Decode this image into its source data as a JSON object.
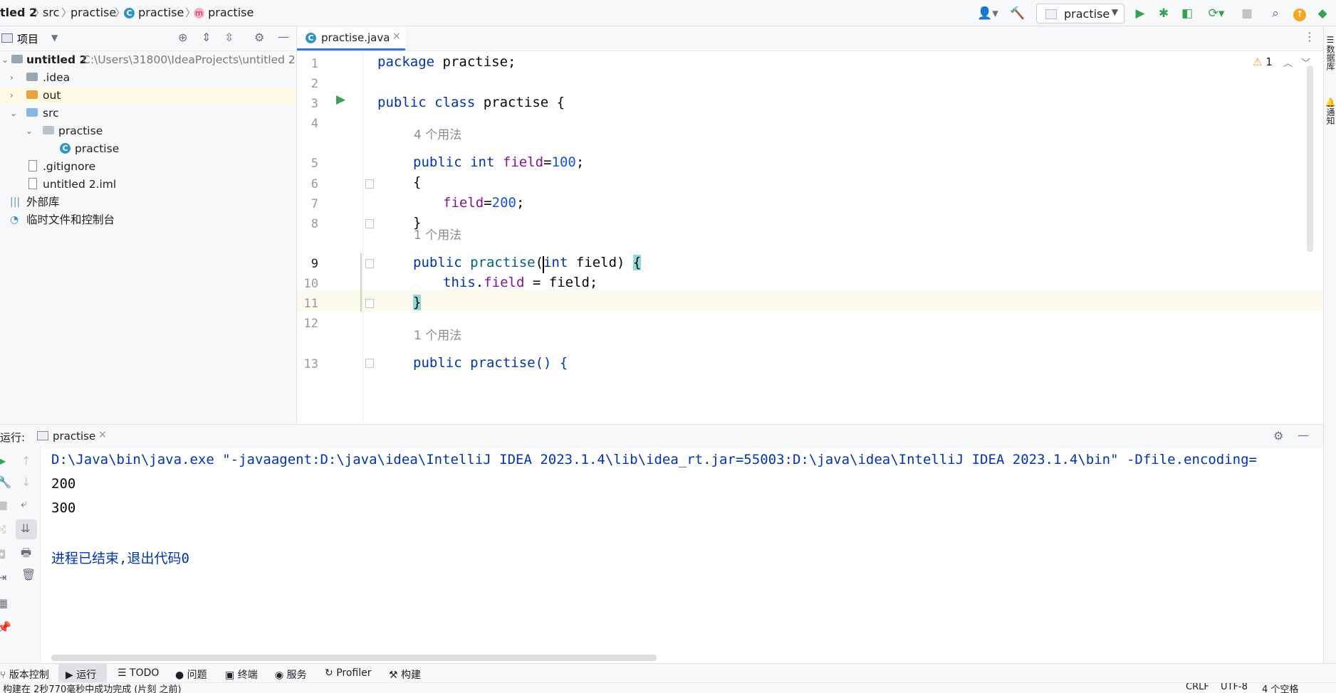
{
  "breadcrumb": {
    "items": [
      "tled 2",
      "src",
      "practise",
      "practise",
      "practise"
    ]
  },
  "toolbar": {
    "run_config": "practise"
  },
  "project_panel": {
    "title": "项目",
    "tree": [
      {
        "label": "untitled 2",
        "path": "C:\\Users\\31800\\IdeaProjects\\untitled 2"
      },
      {
        "label": ".idea"
      },
      {
        "label": "out"
      },
      {
        "label": "src"
      },
      {
        "label": "practise"
      },
      {
        "label": "practise"
      },
      {
        "label": ".gitignore"
      },
      {
        "label": "untitled 2.iml"
      },
      {
        "label": "外部库"
      },
      {
        "label": "临时文件和控制台"
      }
    ]
  },
  "editor": {
    "tab_label": "practise.java",
    "warning_count": "1",
    "line_numbers": [
      "1",
      "2",
      "3",
      "4",
      "5",
      "6",
      "7",
      "8",
      "9",
      "10",
      "11",
      "12",
      "13"
    ],
    "hints": [
      "4 个用法",
      "1 个用法",
      "1 个用法"
    ],
    "code": {
      "l1_kw": "package",
      "l1_rest": " practise;",
      "l3_kw1": "public",
      "l3_kw2": "class",
      "l3_rest": " practise {",
      "l5_kw1": "public",
      "l5_kw2": "int",
      "l5_field": "field",
      "l5_eq": "=",
      "l5_num": "100",
      "l5_end": ";",
      "l6": "{",
      "l7_field": "field",
      "l7_eq": "=",
      "l7_num": "200",
      "l7_end": ";",
      "l8": "}",
      "l9_kw1": "public",
      "l9_fn": "practise",
      "l9_open": "(",
      "l9_kw2": "int",
      "l9_rest": " field) ",
      "l9_brace": "{",
      "l10_kw": "this",
      "l10_dot": ".",
      "l10_field": "field",
      "l10_rest": " = field;",
      "l11_brace": "}",
      "l13": "public practise() {"
    }
  },
  "run_panel": {
    "label": "运行:",
    "tab": "practise",
    "console": [
      "D:\\Java\\bin\\java.exe \"-javaagent:D:\\java\\idea\\IntelliJ IDEA 2023.1.4\\lib\\idea_rt.jar=55003:D:\\java\\idea\\IntelliJ IDEA 2023.1.4\\bin\" -Dfile.encoding=",
      "200",
      "300",
      "进程已结束,退出代码0"
    ]
  },
  "tool_bar": {
    "items": [
      "版本控制",
      "运行",
      "TODO",
      "问题",
      "终端",
      "服务",
      "Profiler",
      "构建"
    ]
  },
  "status_bar": {
    "message": "构建在 2秒770毫秒中成功完成 (片刻 之前)",
    "line_sep": "CRLF",
    "encoding": "UTF-8",
    "indent": "4 个空格"
  },
  "colors": {
    "accent": "#3574f0",
    "keyword": "#0033b3",
    "field": "#871094",
    "number": "#1750eb",
    "run_green": "#3aa152"
  },
  "right_stripe": {
    "db_label": "数据库",
    "notify_label": "通知"
  }
}
